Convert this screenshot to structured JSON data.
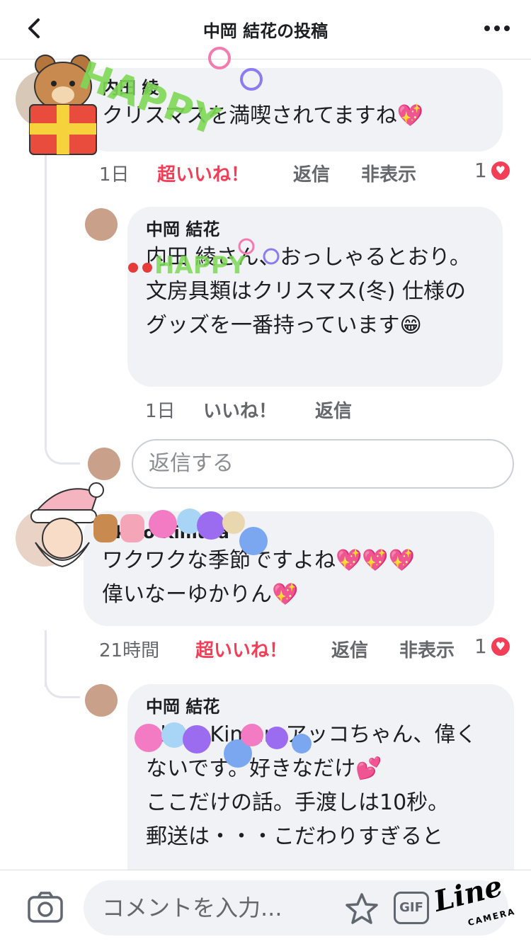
{
  "header": {
    "title": "中岡 結花の投稿"
  },
  "comments": [
    {
      "author": "内田 綾",
      "text": "クリスマスを満喫されてますね💖",
      "time": "1日",
      "reaction_label": "超いいね！",
      "reply_label": "返信",
      "hide_label": "非表示",
      "reaction_count": "1"
    },
    {
      "author": "中岡 結花",
      "text": "内田 綾さん、おっしゃるとおり。文房具類はクリスマス(冬) 仕様のグッズを一番持っています😁",
      "time": "1日",
      "reaction_label": "いいね！",
      "reply_label": "返信"
    },
    {
      "author": "Akiko Kimura",
      "text": "ワクワクな季節ですよね💖💖💖\n偉いなーゆかりん💖",
      "time": "21時間",
      "reaction_label": "超いいね！",
      "reply_label": "返信",
      "hide_label": "非表示",
      "reaction_count": "1"
    },
    {
      "author": "中岡 結花",
      "text": "Akiko Kimuraアッコちゃん、偉くないです。好きなだけ💕\nここだけの話。手渡しは10秒。\n郵送は・・・こだわりすぎると"
    }
  ],
  "reply_input": {
    "placeholder": "返信する"
  },
  "composer": {
    "placeholder": "コメントを入力..."
  },
  "gif_label": "GIF",
  "watermark": {
    "line": "Line",
    "camera": "CAMERA"
  },
  "stickers": {
    "happy": "HAPPY"
  },
  "colors": {
    "love": "#f33e58",
    "bubble": "#f0f2f5",
    "meta": "#65676b"
  },
  "icons": [
    "back-icon",
    "more-icon",
    "camera-icon",
    "sticker-icon",
    "gif-icon",
    "heart-icon"
  ]
}
